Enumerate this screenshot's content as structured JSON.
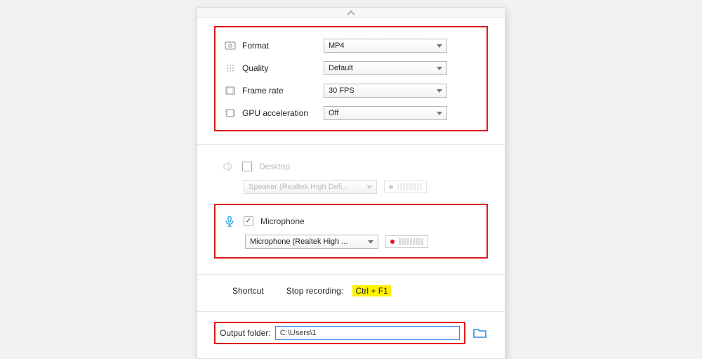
{
  "video_settings": {
    "format": {
      "label": "Format",
      "value": "MP4"
    },
    "quality": {
      "label": "Quality",
      "value": "Default"
    },
    "frame_rate": {
      "label": "Frame rate",
      "value": "30 FPS"
    },
    "gpu_accel": {
      "label": "GPU acceleration",
      "value": "Off"
    }
  },
  "audio": {
    "desktop": {
      "label": "Desktop",
      "checked": false,
      "device": "Speaker (Realtek High Defi..."
    },
    "microphone": {
      "label": "Microphone",
      "checked": true,
      "device": "Microphone (Realtek High ..."
    }
  },
  "shortcut": {
    "label": "Shortcut",
    "action_label": "Stop recording:",
    "hotkey": "Ctrl + F1"
  },
  "output": {
    "label": "Output folder:",
    "path": "C:\\Users\\1"
  }
}
